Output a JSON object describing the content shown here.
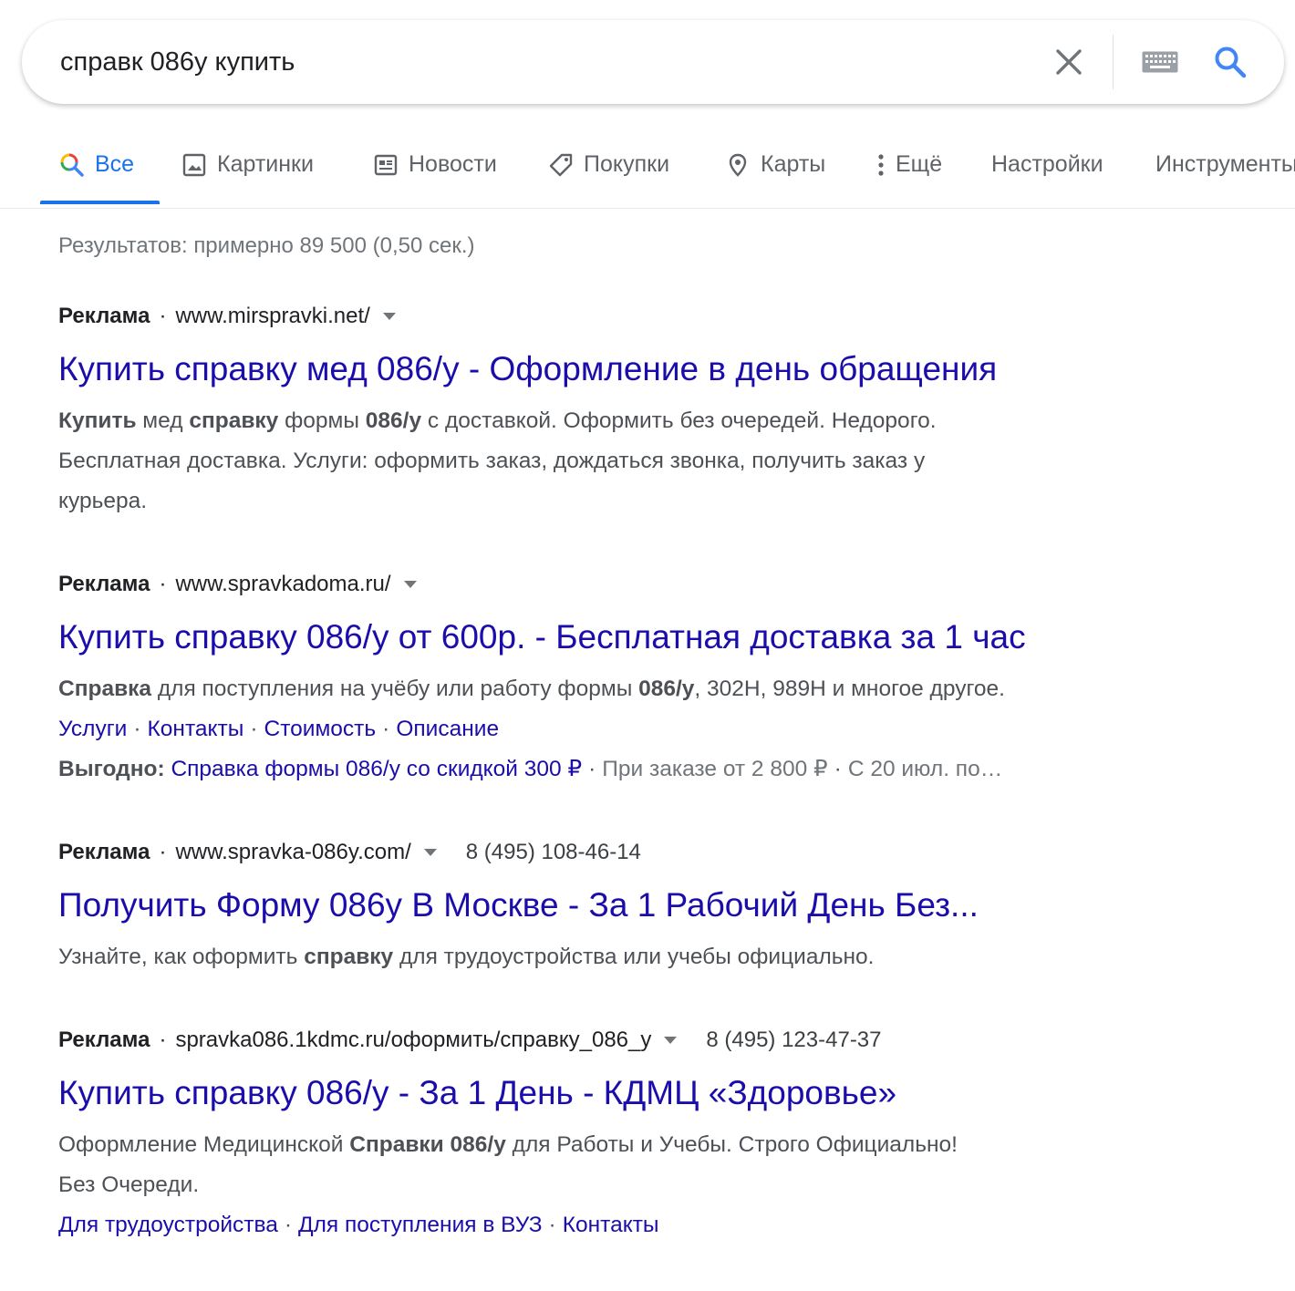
{
  "search": {
    "query": "справк 086у купить"
  },
  "tabs": [
    {
      "label": "Все",
      "icon": "search-icon",
      "active": true
    },
    {
      "label": "Картинки",
      "icon": "image-icon"
    },
    {
      "label": "Новости",
      "icon": "news-icon"
    },
    {
      "label": "Покупки",
      "icon": "tag-icon"
    },
    {
      "label": "Карты",
      "icon": "map-pin-icon"
    },
    {
      "label": "Ещё",
      "icon": "more-vert-icon"
    },
    {
      "label": "Настройки"
    },
    {
      "label": "Инструменты"
    }
  ],
  "stats": "Результатов: примерно 89 500 (0,50 сек.)",
  "ads": [
    {
      "label": "Реклама",
      "url": "www.mirspravki.net/",
      "title": "Купить справку мед 086/у - Оформление в день обращения",
      "desc": [
        {
          "t": "Купить",
          "b": true
        },
        {
          "t": " мед "
        },
        {
          "t": "справку",
          "b": true
        },
        {
          "t": " формы "
        },
        {
          "t": "086/у",
          "b": true
        },
        {
          "t": " с доставкой. Оформить без очередей. Недорого."
        },
        {
          "br": true
        },
        {
          "t": "Бесплатная доставка. Услуги: оформить заказ, дождаться звонка, получить заказ у"
        },
        {
          "br": true
        },
        {
          "t": "курьера."
        }
      ]
    },
    {
      "label": "Реклама",
      "url": "www.spravkadoma.ru/",
      "title": "Купить справку 086/у от 600р. - Бесплатная доставка за 1 час",
      "desc": [
        {
          "t": "Справка",
          "b": true
        },
        {
          "t": " для поступления на учёбу или работу формы "
        },
        {
          "t": "086/у",
          "b": true
        },
        {
          "t": ", 302Н, 989Н и многое другое."
        }
      ],
      "sitelinks": [
        "Услуги",
        "Контакты",
        "Стоимость",
        "Описание"
      ],
      "promo": {
        "label": "Выгодно:",
        "link": "Справка формы 086/у со скидкой 300 ₽",
        "rest": [
          "При заказе от 2 800 ₽",
          "С 20 июл. по…"
        ]
      }
    },
    {
      "label": "Реклама",
      "url": "www.spravka-086y.com/",
      "phone": "8 (495) 108-46-14",
      "title": "Получить Форму 086у В Москве - За 1 Рабочий День Без...",
      "desc": [
        {
          "t": "Узнайте, как оформить "
        },
        {
          "t": "справку",
          "b": true
        },
        {
          "t": " для трудоустройства или учебы официально."
        }
      ]
    },
    {
      "label": "Реклама",
      "url": "spravka086.1kdmc.ru/оформить/справку_086_у",
      "phone": "8 (495) 123-47-37",
      "title": "Купить справку 086/у - За 1 День - КДМЦ «Здоровье»",
      "desc": [
        {
          "t": "Оформление Медицинской "
        },
        {
          "t": "Справки 086/у",
          "b": true
        },
        {
          "t": " для Работы и Учебы. Строго Официально!"
        },
        {
          "br": true
        },
        {
          "t": "Без Очереди."
        }
      ],
      "sitelinks": [
        "Для трудоустройства",
        "Для поступления в ВУЗ",
        "Контакты"
      ]
    }
  ],
  "colors": {
    "link": "#1a0dab",
    "accent": "#1a73e8",
    "muted": "#70757a"
  }
}
